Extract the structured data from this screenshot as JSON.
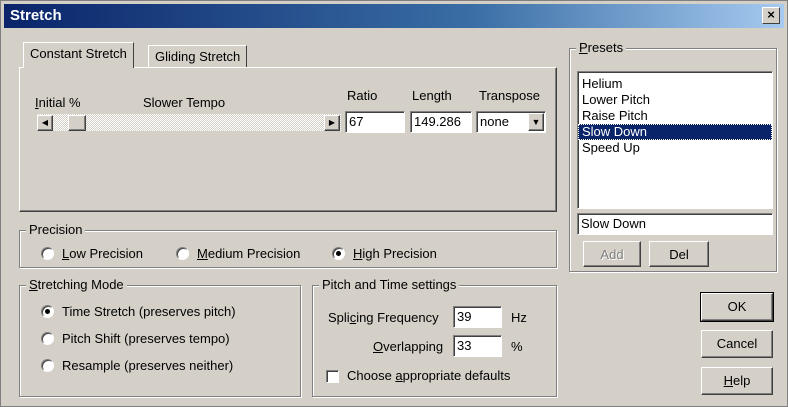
{
  "window": {
    "title": "Stretch",
    "close_glyph": "×"
  },
  "tabs": [
    {
      "label": "Constant Stretch"
    },
    {
      "label": "Gliding Stretch"
    }
  ],
  "constant": {
    "initial_label_u": "I",
    "initial_label_rest": "nitial %",
    "slower_tempo": "Slower Tempo",
    "ratio_label": "Ratio",
    "ratio_value": "67",
    "length_label": "Length",
    "length_value": "149.286",
    "transpose_label": "Transpose",
    "transpose_value": "none",
    "slider_level_percent": 6
  },
  "precision": {
    "label": "Precision",
    "options": [
      {
        "u": "L",
        "rest": "ow Precision",
        "checked": false
      },
      {
        "u": "M",
        "rest": "edium Precision",
        "checked": false
      },
      {
        "u": "H",
        "rest": "igh Precision",
        "checked": true
      }
    ]
  },
  "stretching_mode": {
    "label_u": "S",
    "label_rest": "tretching Mode",
    "options": [
      {
        "label": "Time Stretch (preserves pitch)",
        "checked": true
      },
      {
        "label": "Pitch Shift (preserves tempo)",
        "checked": false
      },
      {
        "label": "Resample (preserves neither)",
        "checked": false
      }
    ]
  },
  "pitch_time": {
    "label": "Pitch and Time settings",
    "splicing_pre": "Spli",
    "splicing_u": "c",
    "splicing_post": "ing Frequency",
    "splicing_value": "39",
    "splicing_unit": "Hz",
    "overlap_u": "O",
    "overlap_rest": "verlapping",
    "overlap_value": "33",
    "overlap_unit": "%",
    "defaults_pre": "Choose ",
    "defaults_u": "a",
    "defaults_post": "ppropriate defaults",
    "defaults_checked": false
  },
  "presets": {
    "label_u": "P",
    "label_rest": "resets",
    "items": [
      "Helium",
      "Lower Pitch",
      "Raise Pitch",
      "Slow Down",
      "Speed Up"
    ],
    "selected": "Slow Down",
    "name_value": "Slow Down",
    "add_label": "Add",
    "del_label": "Del"
  },
  "buttons": {
    "ok": "OK",
    "cancel": "Cancel",
    "help_u": "H",
    "help_rest": "elp"
  },
  "icons": {
    "left": "triangle-left",
    "right": "triangle-right",
    "down": "triangle-down"
  }
}
